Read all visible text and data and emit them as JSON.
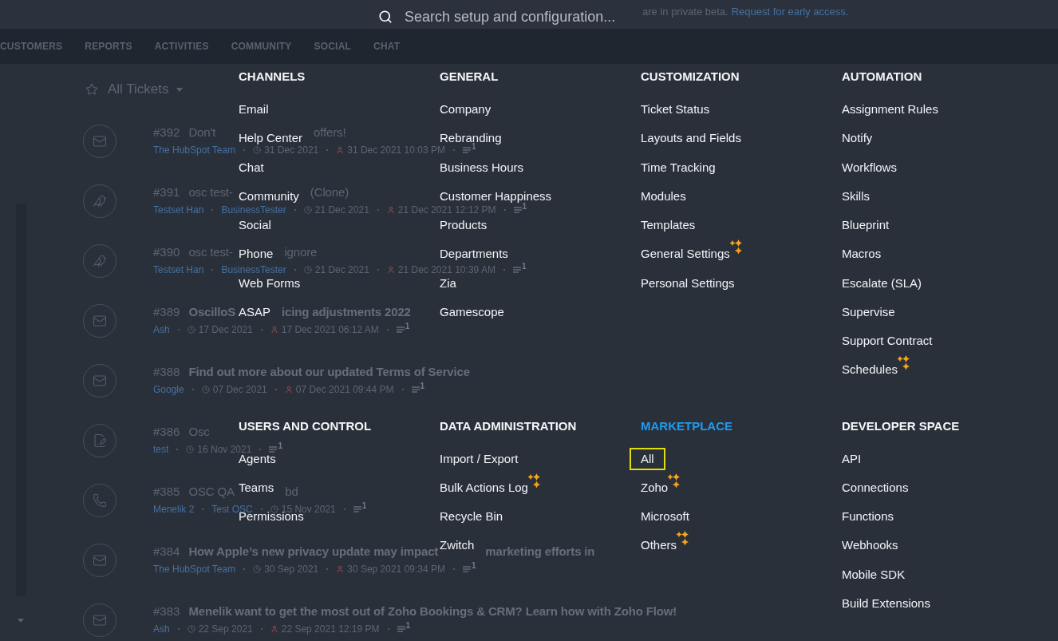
{
  "top_bar": {
    "search": {
      "placeholder": "Search setup and configuration..."
    },
    "banner": {
      "text": "are in private beta.",
      "link": "Request for early access."
    }
  },
  "nav_tabs": [
    "CUSTOMERS",
    "REPORTS",
    "ACTIVITIES",
    "COMMUNITY",
    "SOCIAL",
    "CHAT"
  ],
  "list_header": {
    "title": "All Tickets"
  },
  "tickets": [
    {
      "number": "#392",
      "title_parts": [
        "Don't",
        "offers!"
      ],
      "unread": false,
      "kind": "email",
      "links": [
        "The HubSpot Team"
      ],
      "created": "31 Dec 2021",
      "due": "31 Dec 2021 10:03 PM",
      "threads": "1"
    },
    {
      "number": "#391",
      "title_parts": [
        "osc test-",
        "(Clone)"
      ],
      "unread": false,
      "kind": "social",
      "links": [
        "Testset Han",
        "BusinessTester"
      ],
      "created": "21 Dec 2021",
      "due": "21 Dec 2021 12:12 PM",
      "threads": "1"
    },
    {
      "number": "#390",
      "title_parts": [
        "osc test-",
        "ignore"
      ],
      "unread": false,
      "kind": "social",
      "links": [
        "Testset Han",
        "BusinessTester"
      ],
      "created": "21 Dec 2021",
      "due": "21 Dec 2021 10:39 AM",
      "threads": "1"
    },
    {
      "number": "#389",
      "title_parts": [
        "OscilloS",
        "icing adjustments 2022"
      ],
      "unread": true,
      "kind": "email",
      "links": [
        "Ash"
      ],
      "created": "17 Dec 2021",
      "due": "17 Dec 2021 06:12 AM",
      "threads": "1"
    },
    {
      "number": "#388",
      "title_parts": [
        "Find out more about our updated Terms of Service"
      ],
      "unread": true,
      "kind": "email",
      "links": [
        "Google"
      ],
      "created": "07 Dec 2021",
      "due": "07 Dec 2021 09:44 PM",
      "threads": "1"
    },
    {
      "number": "#386",
      "title_parts": [
        "Osc"
      ],
      "unread": false,
      "kind": "form",
      "links": [
        "test"
      ],
      "created": "16 Nov 2021",
      "threads": "1"
    },
    {
      "number": "#385",
      "title_parts": [
        "OSC QA",
        "bd"
      ],
      "unread": false,
      "kind": "phone",
      "links": [
        "Menelik 2",
        "Test OSC"
      ],
      "created": "15 Nov 2021",
      "threads": "1"
    },
    {
      "number": "#384",
      "title_parts": [
        "How Apple’s new privacy update may impact",
        "marketing efforts in"
      ],
      "unread": true,
      "kind": "email",
      "links": [
        "The HubSpot Team"
      ],
      "created": "30 Sep 2021",
      "due": "30 Sep 2021 09:34 PM",
      "threads": "1"
    },
    {
      "number": "#383",
      "title_parts": [
        "Menelik want to get the most out of Zoho Bookings & CRM? Learn how with Zoho Flow!"
      ],
      "unread": true,
      "kind": "email",
      "links": [
        "Ash"
      ],
      "created": "22 Sep 2021",
      "due": "22 Sep 2021 12:19 PM",
      "threads": "1"
    }
  ],
  "setup_menu": {
    "sections": [
      {
        "title": "CHANNELS",
        "active": false,
        "items": [
          {
            "label": "Email",
            "new": false,
            "focused": false
          },
          {
            "label": "Help Center",
            "new": false,
            "focused": false
          },
          {
            "label": "Chat",
            "new": false,
            "focused": false
          },
          {
            "label": "Community",
            "new": false,
            "focused": false
          },
          {
            "label": "Social",
            "new": false,
            "focused": false
          },
          {
            "label": "Phone",
            "new": false,
            "focused": false
          },
          {
            "label": "Web Forms",
            "new": false,
            "focused": false
          },
          {
            "label": "ASAP",
            "new": false,
            "focused": false
          }
        ]
      },
      {
        "title": "GENERAL",
        "active": false,
        "items": [
          {
            "label": "Company",
            "new": false,
            "focused": false
          },
          {
            "label": "Rebranding",
            "new": false,
            "focused": false
          },
          {
            "label": "Business Hours",
            "new": false,
            "focused": false
          },
          {
            "label": "Customer Happiness",
            "new": false,
            "focused": false
          },
          {
            "label": "Products",
            "new": false,
            "focused": false
          },
          {
            "label": "Departments",
            "new": false,
            "focused": false
          },
          {
            "label": "Zia",
            "new": false,
            "focused": false
          },
          {
            "label": "Gamescope",
            "new": false,
            "focused": false
          }
        ]
      },
      {
        "title": "CUSTOMIZATION",
        "active": false,
        "items": [
          {
            "label": "Ticket Status",
            "new": false,
            "focused": false
          },
          {
            "label": "Layouts and Fields",
            "new": false,
            "focused": false
          },
          {
            "label": "Time Tracking",
            "new": false,
            "focused": false
          },
          {
            "label": "Modules",
            "new": false,
            "focused": false
          },
          {
            "label": "Templates",
            "new": false,
            "focused": false
          },
          {
            "label": "General Settings",
            "new": true,
            "focused": false
          },
          {
            "label": "Personal Settings",
            "new": false,
            "focused": false
          }
        ]
      },
      {
        "title": "AUTOMATION",
        "active": false,
        "items": [
          {
            "label": "Assignment Rules",
            "new": false,
            "focused": false
          },
          {
            "label": "Notify",
            "new": false,
            "focused": false
          },
          {
            "label": "Workflows",
            "new": false,
            "focused": false
          },
          {
            "label": "Skills",
            "new": false,
            "focused": false
          },
          {
            "label": "Blueprint",
            "new": false,
            "focused": false
          },
          {
            "label": "Macros",
            "new": false,
            "focused": false
          },
          {
            "label": "Escalate (SLA)",
            "new": false,
            "focused": false
          },
          {
            "label": "Supervise",
            "new": false,
            "focused": false
          },
          {
            "label": "Support Contract",
            "new": false,
            "focused": false
          },
          {
            "label": "Schedules",
            "new": true,
            "focused": false
          }
        ]
      },
      {
        "title": "USERS AND CONTROL",
        "active": false,
        "items": [
          {
            "label": "Agents",
            "new": false,
            "focused": false
          },
          {
            "label": "Teams",
            "new": false,
            "focused": false
          },
          {
            "label": "Permissions",
            "new": false,
            "focused": false
          }
        ]
      },
      {
        "title": "DATA ADMINISTRATION",
        "active": false,
        "items": [
          {
            "label": "Import / Export",
            "new": false,
            "focused": false
          },
          {
            "label": "Bulk Actions Log",
            "new": true,
            "focused": false
          },
          {
            "label": "Recycle Bin",
            "new": false,
            "focused": false
          },
          {
            "label": "Zwitch",
            "new": false,
            "focused": false
          }
        ]
      },
      {
        "title": "MARKETPLACE",
        "active": true,
        "items": [
          {
            "label": "All",
            "new": false,
            "focused": true
          },
          {
            "label": "Zoho",
            "new": true,
            "focused": false
          },
          {
            "label": "Microsoft",
            "new": false,
            "focused": false
          },
          {
            "label": "Others",
            "new": true,
            "focused": false
          }
        ]
      },
      {
        "title": "DEVELOPER SPACE",
        "active": false,
        "items": [
          {
            "label": "API",
            "new": false,
            "focused": false
          },
          {
            "label": "Connections",
            "new": false,
            "focused": false
          },
          {
            "label": "Functions",
            "new": false,
            "focused": false
          },
          {
            "label": "Webhooks",
            "new": false,
            "focused": false
          },
          {
            "label": "Mobile SDK",
            "new": false,
            "focused": false
          },
          {
            "label": "Build Extensions",
            "new": false,
            "focused": false
          }
        ]
      }
    ]
  }
}
